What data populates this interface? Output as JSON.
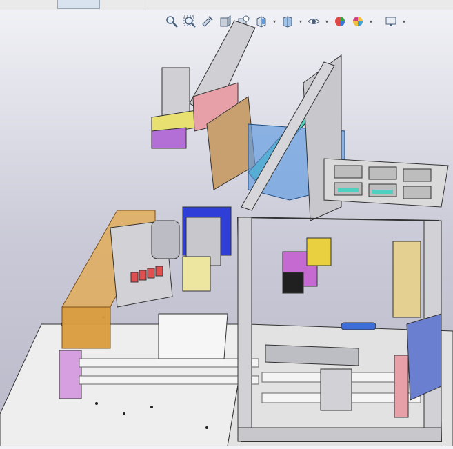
{
  "window": {
    "tabs": [
      "",
      ""
    ]
  },
  "heads_up_toolbar": {
    "buttons": [
      {
        "name": "zoom-to-fit-icon"
      },
      {
        "name": "zoom-to-area-icon"
      },
      {
        "name": "previous-view-icon"
      },
      {
        "name": "section-view-icon"
      },
      {
        "name": "dynamic-annotation-icon"
      },
      {
        "name": "view-orientation-icon",
        "dropdown": true
      },
      {
        "name": "display-style-icon",
        "dropdown": true
      },
      {
        "name": "hide-show-items-icon",
        "dropdown": true
      },
      {
        "name": "edit-appearance-icon"
      },
      {
        "name": "apply-scene-icon",
        "dropdown": true
      },
      {
        "name": "view-settings-icon",
        "dropdown": true
      }
    ]
  },
  "colors": {
    "background_top": "#f2f3f7",
    "background_bottom": "#b9b9c9",
    "frame_gray": "#c8c8cc",
    "amber_cover": "#e4a94a",
    "blue_cover": "#5d9ae0",
    "purple_part": "#b46fd6",
    "yellow_part": "#e8e070",
    "pink_part": "#e8a0a8",
    "cyan_part": "#4fd0c0"
  }
}
